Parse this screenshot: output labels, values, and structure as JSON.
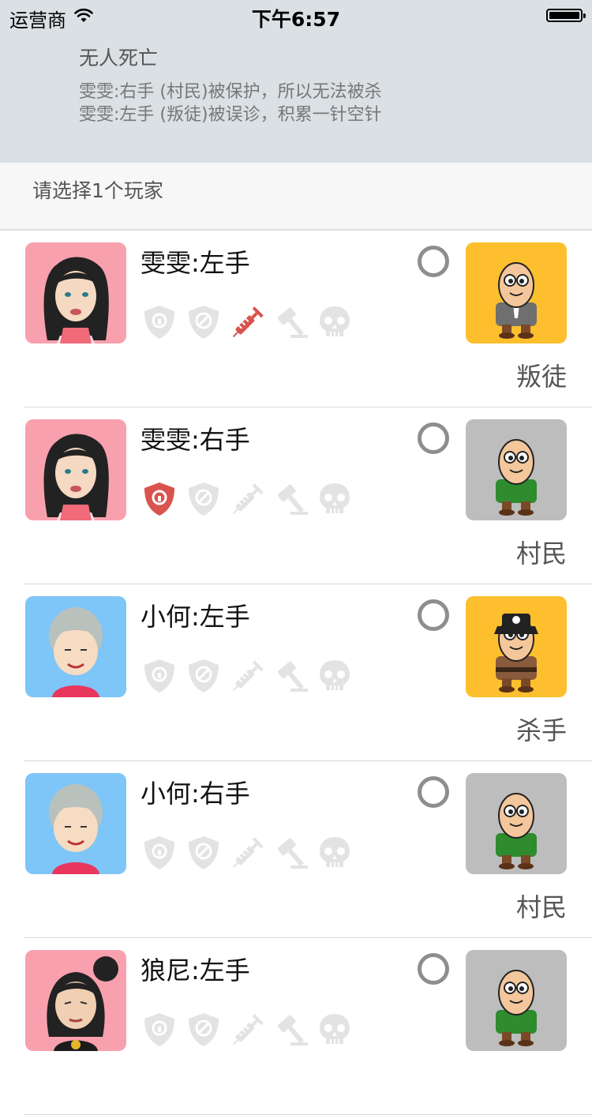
{
  "status_bar": {
    "carrier": "运营商",
    "time": "下午6:57"
  },
  "notice": {
    "title": "无人死亡",
    "line1": "雯雯:右手 (村民)被保护，所以无法被杀",
    "line2": "雯雯:左手 (叛徒)被误诊，积累一针空针"
  },
  "prompt": "请选择1个玩家",
  "colors": {
    "notice_bg": "#dae0e3",
    "active_icon": "#d9534f",
    "inactive_icon": "#e3e3e3",
    "avatar_pink": "#f9a0ae",
    "avatar_blue": "#7ec5f8",
    "role_yellow": "#fdbf2d",
    "role_gray": "#bdbdbd"
  },
  "players": [
    {
      "name": "雯雯:左手",
      "avatar": "girl-long-hair",
      "avatar_bg": "#f9a0ae",
      "role": "叛徒",
      "role_icon": "traitor",
      "role_bg": "#fdbf2d",
      "status_icons": [
        "shield-lock-icon",
        "shield-ban-icon",
        "syringe-icon",
        "gavel-icon",
        "skull-icon"
      ],
      "active_icons": [
        "syringe-icon"
      ]
    },
    {
      "name": "雯雯:右手",
      "avatar": "girl-long-hair",
      "avatar_bg": "#f9a0ae",
      "role": "村民",
      "role_icon": "villager",
      "role_bg": "#bdbdbd",
      "status_icons": [
        "shield-lock-icon",
        "shield-ban-icon",
        "syringe-icon",
        "gavel-icon",
        "skull-icon"
      ],
      "active_icons": [
        "shield-lock-icon"
      ]
    },
    {
      "name": "小何:左手",
      "avatar": "boy-gray-hair",
      "avatar_bg": "#7ec5f8",
      "role": "杀手",
      "role_icon": "killer",
      "role_bg": "#fdbf2d",
      "status_icons": [
        "shield-lock-icon",
        "shield-ban-icon",
        "syringe-icon",
        "gavel-icon",
        "skull-icon"
      ],
      "active_icons": []
    },
    {
      "name": "小何:右手",
      "avatar": "boy-gray-hair",
      "avatar_bg": "#7ec5f8",
      "role": "村民",
      "role_icon": "villager",
      "role_bg": "#bdbdbd",
      "status_icons": [
        "shield-lock-icon",
        "shield-ban-icon",
        "syringe-icon",
        "gavel-icon",
        "skull-icon"
      ],
      "active_icons": []
    },
    {
      "name": "狼尼:左手",
      "avatar": "girl-bun-hair",
      "avatar_bg": "#f9a0ae",
      "role": "",
      "role_icon": "villager",
      "role_bg": "#bdbdbd",
      "status_icons": [
        "shield-lock-icon",
        "shield-ban-icon",
        "syringe-icon",
        "gavel-icon",
        "skull-icon"
      ],
      "active_icons": []
    }
  ]
}
